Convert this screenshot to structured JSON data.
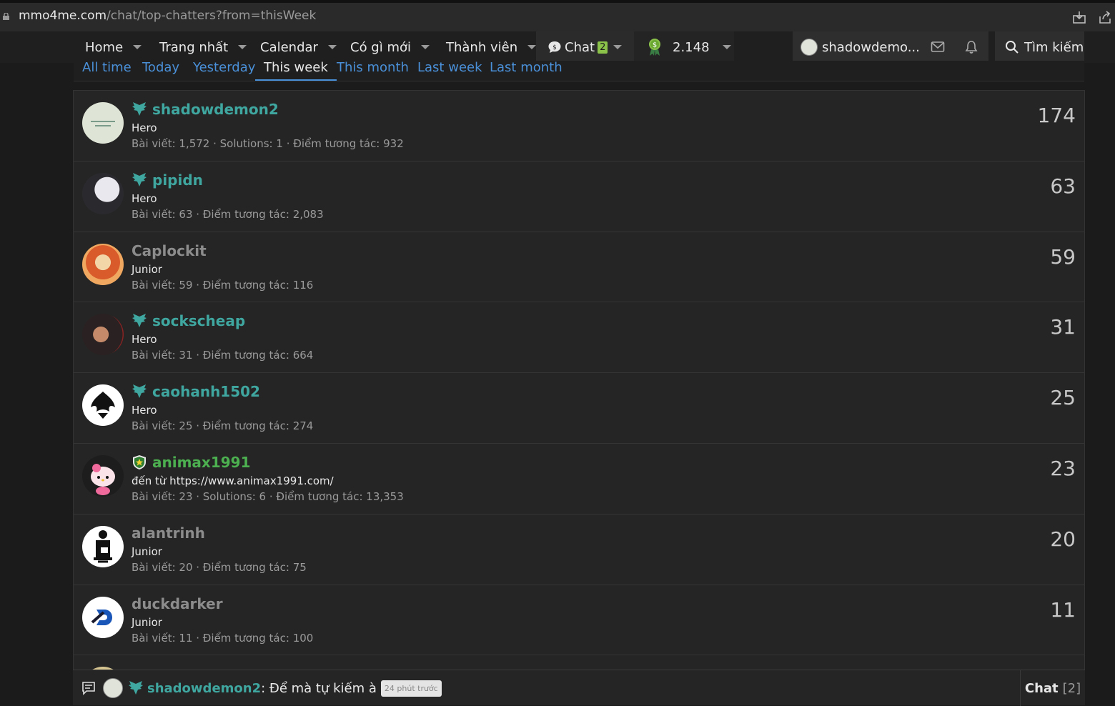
{
  "browser": {
    "url_host": "mmo4me.com",
    "url_path": "/chat/top-chatters?from=thisWeek"
  },
  "nav": {
    "items": [
      {
        "label": "Home"
      },
      {
        "label": "Trang nhất"
      },
      {
        "label": "Calendar"
      },
      {
        "label": "Có gì mới"
      },
      {
        "label": "Thành viên"
      }
    ],
    "chat_label": "Chat",
    "chat_badge": "2",
    "coins": "2.148",
    "username": "shadowdemo...",
    "search_label": "Tìm kiếm"
  },
  "tabs": [
    {
      "label": "All time"
    },
    {
      "label": "Today"
    },
    {
      "label": "Yesterday"
    },
    {
      "label": "This week",
      "active": true
    },
    {
      "label": "This month"
    },
    {
      "label": "Last week"
    },
    {
      "label": "Last month"
    }
  ],
  "users": [
    {
      "name": "shadowdemon2",
      "title": "Hero",
      "stats": "Bài viết: 1,572 · Solutions: 1 · Điểm tương tác: 932",
      "count": "174",
      "rank": "hero"
    },
    {
      "name": "pipidn",
      "title": "Hero",
      "stats": "Bài viết: 63 · Điểm tương tác: 2,083",
      "count": "63",
      "rank": "hero"
    },
    {
      "name": "Caplockit",
      "title": "Junior",
      "stats": "Bài viết: 59 · Điểm tương tác: 116",
      "count": "59",
      "rank": "junior"
    },
    {
      "name": "sockscheap",
      "title": "Hero",
      "stats": "Bài viết: 31 · Điểm tương tác: 664",
      "count": "31",
      "rank": "hero"
    },
    {
      "name": "caohanh1502",
      "title": "Hero",
      "stats": "Bài viết: 25 · Điểm tương tác: 274",
      "count": "25",
      "rank": "hero"
    },
    {
      "name": "animax1991",
      "title": "đến từ https://www.animax1991.com/",
      "stats": "Bài viết: 23 · Solutions: 6 · Điểm tương tác: 13,353",
      "count": "23",
      "rank": "vip"
    },
    {
      "name": "alantrinh",
      "title": "Junior",
      "stats": "Bài viết: 20 · Điểm tương tác: 75",
      "count": "20",
      "rank": "junior"
    },
    {
      "name": "duckdarker",
      "title": "Junior",
      "stats": "Bài viết: 11 · Điểm tương tác: 100",
      "count": "11",
      "rank": "junior"
    }
  ],
  "chatbar": {
    "author": "shadowdemon2",
    "message": ": Để mà tự kiếm à",
    "time": "24 phút trước",
    "label": "Chat",
    "count": "[2]"
  },
  "colors": {
    "hero": "#3fa7a0",
    "junior": "#8c8c8c",
    "vip": "#4caf50",
    "link": "#4a90d9"
  }
}
